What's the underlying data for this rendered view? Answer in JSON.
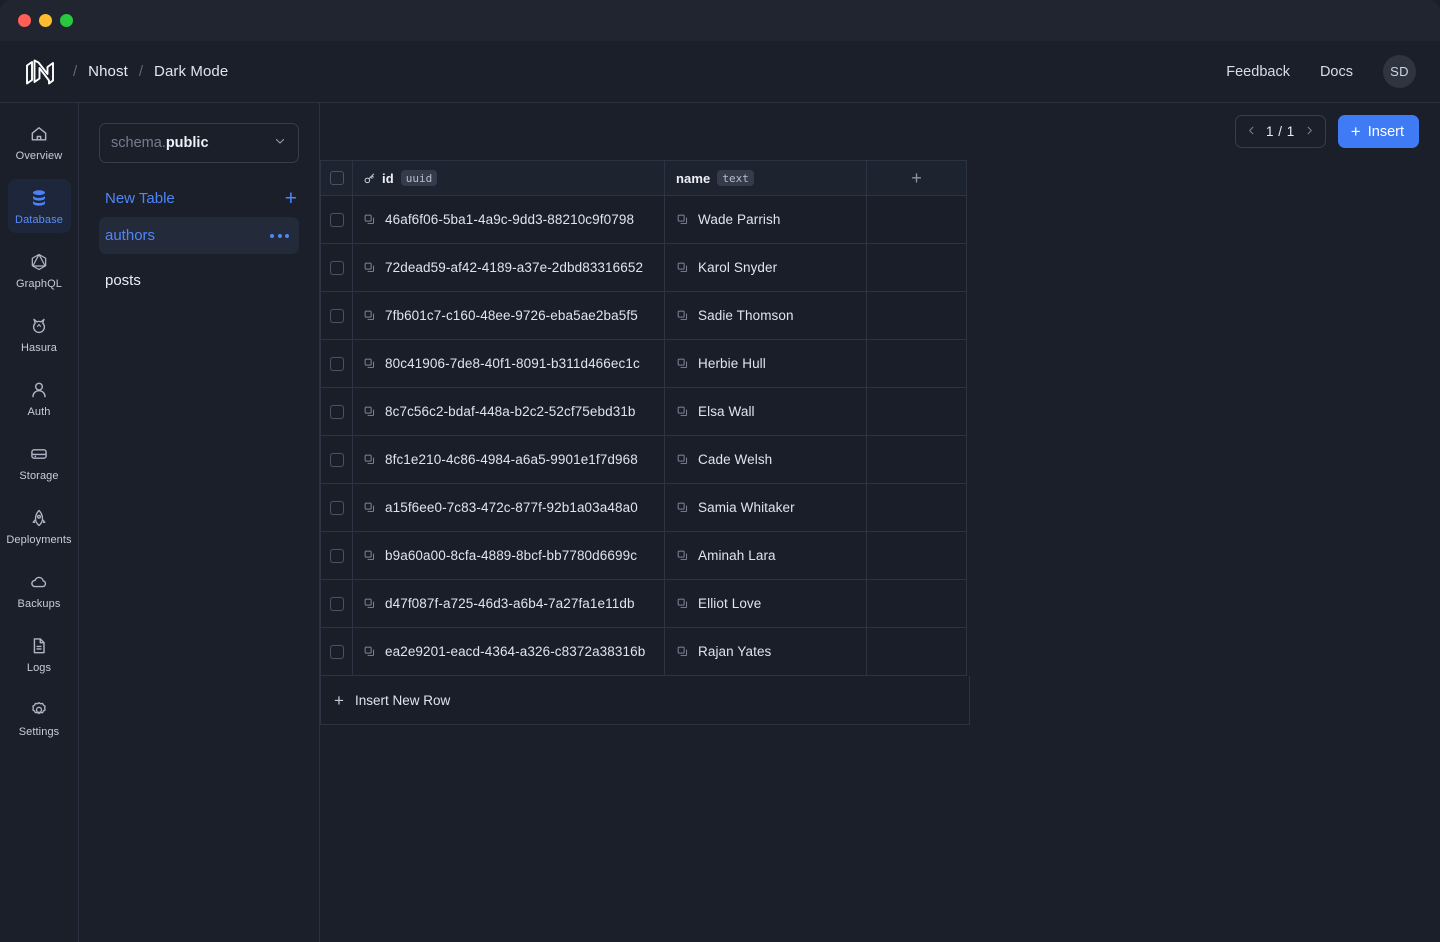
{
  "window": {
    "traffic_lights": [
      "close",
      "minimize",
      "zoom"
    ],
    "colors": {
      "close": "#ff5f57",
      "minimize": "#febc2e",
      "zoom": "#28c840",
      "accent": "#3f7bf5",
      "link": "#4f86f7"
    }
  },
  "topbar": {
    "logo_icon": "nhost-logo-icon",
    "breadcrumb": [
      {
        "label": "Nhost"
      },
      {
        "label": "Dark Mode"
      }
    ],
    "separator": "/",
    "feedback_label": "Feedback",
    "docs_label": "Docs",
    "avatar_initials": "SD"
  },
  "rail": {
    "items": [
      {
        "label": "Overview",
        "icon": "home-icon",
        "active": false
      },
      {
        "label": "Database",
        "icon": "database-icon",
        "active": true
      },
      {
        "label": "GraphQL",
        "icon": "graphql-icon",
        "active": false
      },
      {
        "label": "Hasura",
        "icon": "hasura-icon",
        "active": false
      },
      {
        "label": "Auth",
        "icon": "user-icon",
        "active": false
      },
      {
        "label": "Storage",
        "icon": "storage-icon",
        "active": false
      },
      {
        "label": "Deployments",
        "icon": "rocket-icon",
        "active": false
      },
      {
        "label": "Backups",
        "icon": "cloud-icon",
        "active": false
      },
      {
        "label": "Logs",
        "icon": "document-icon",
        "active": false
      },
      {
        "label": "Settings",
        "icon": "gear-icon",
        "active": false
      }
    ]
  },
  "tables_pane": {
    "schema_selector": {
      "prefix": "schema.",
      "value": "public",
      "chevron_icon": "chevron-down-icon"
    },
    "new_table_label": "New Table",
    "new_table_icon": "plus-icon",
    "tables": [
      {
        "name": "authors",
        "active": true,
        "menu_icon": "more-horizontal-icon"
      },
      {
        "name": "posts",
        "active": false,
        "menu_icon": null
      }
    ]
  },
  "toolbar": {
    "pager": {
      "prev_icon": "chevron-left-icon",
      "next_icon": "chevron-right-icon",
      "current_page": 1,
      "total_pages": 1,
      "label": "1 / 1"
    },
    "insert_label": "Insert",
    "insert_icon": "plus-icon"
  },
  "grid": {
    "columns": [
      {
        "name": "id",
        "type": "uuid",
        "primary_key": true,
        "key_icon": "key-icon"
      },
      {
        "name": "name",
        "type": "text",
        "primary_key": false,
        "key_icon": null
      }
    ],
    "add_column_icon": "plus-icon",
    "row_select_icon": "checkbox-icon",
    "cell_copy_icon": "copy-icon",
    "rows": [
      {
        "id": "46af6f06-5ba1-4a9c-9dd3-88210c9f0798",
        "name": "Wade Parrish"
      },
      {
        "id": "72dead59-af42-4189-a37e-2dbd83316652",
        "name": "Karol Snyder"
      },
      {
        "id": "7fb601c7-c160-48ee-9726-eba5ae2ba5f5",
        "name": "Sadie Thomson"
      },
      {
        "id": "80c41906-7de8-40f1-8091-b311d466ec1c",
        "name": "Herbie Hull"
      },
      {
        "id": "8c7c56c2-bdaf-448a-b2c2-52cf75ebd31b",
        "name": "Elsa Wall"
      },
      {
        "id": "8fc1e210-4c86-4984-a6a5-9901e1f7d968",
        "name": "Cade Welsh"
      },
      {
        "id": "a15f6ee0-7c83-472c-877f-92b1a03a48a0",
        "name": "Samia Whitaker"
      },
      {
        "id": "b9a60a00-8cfa-4889-8bcf-bb7780d6699c",
        "name": "Aminah Lara"
      },
      {
        "id": "d47f087f-a725-46d3-a6b4-7a27fa1e11db",
        "name": "Elliot Love"
      },
      {
        "id": "ea2e9201-eacd-4364-a326-c8372a38316b",
        "name": "Rajan Yates"
      }
    ],
    "insert_row_label": "Insert New Row",
    "insert_row_icon": "plus-icon"
  }
}
